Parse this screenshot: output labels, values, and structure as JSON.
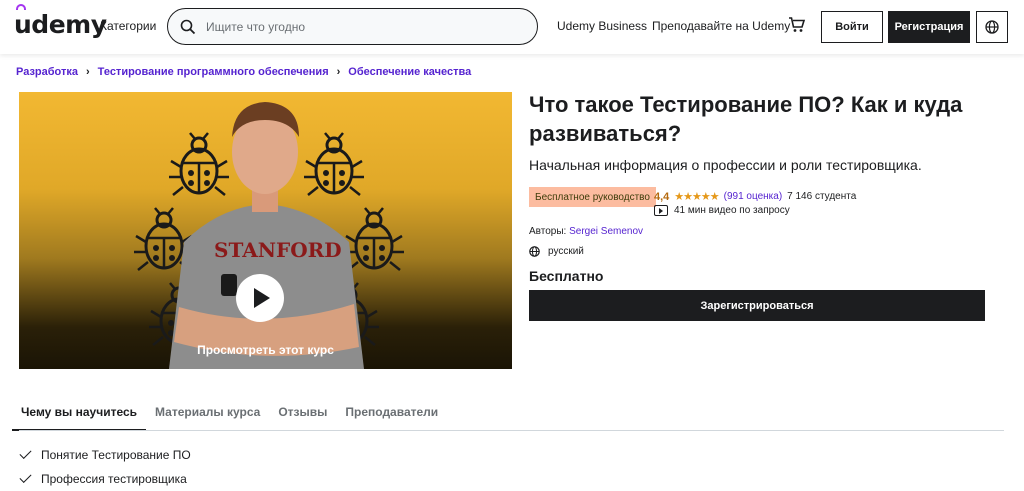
{
  "header": {
    "logo": "udemy",
    "categories": "Категории",
    "search_placeholder": "Ищите что угодно",
    "business": "Udemy Business",
    "teach": "Преподавайте на Udemy",
    "login": "Войти",
    "signup": "Регистрация"
  },
  "breadcrumb": [
    "Разработка",
    "Тестирование программного обеспечения",
    "Обеспечение качества"
  ],
  "video": {
    "preview_label": "Просмотреть этот курс",
    "shirt_text": "STANFORD"
  },
  "course": {
    "title": "Что такое Тестирование ПО? Как и куда развиваться?",
    "subtitle": "Начальная информация о профессии и роли тестировщика.",
    "badge": "Бесплатное руководство",
    "rating": "4,4",
    "rating_value": 4.4,
    "reviews": "(991 оценка)",
    "students": "7 146 студента",
    "duration": "41 мин видео по запросу",
    "authors_label": "Авторы:",
    "author": "Sergei Semenov",
    "language": "русский",
    "price": "Бесплатно",
    "enroll": "Зарегистрироваться"
  },
  "tabs": [
    "Чему вы научитесь",
    "Материалы курса",
    "Отзывы",
    "Преподаватели"
  ],
  "learn": [
    "Понятие Тестирование ПО",
    "Профессия тестировщика"
  ],
  "colors": {
    "accent": "#a435f0",
    "link": "#5624d0",
    "badge_bg": "#fcbca0",
    "rating": "#b4690e",
    "stars": "#e59819",
    "dark": "#1c1d1f"
  }
}
